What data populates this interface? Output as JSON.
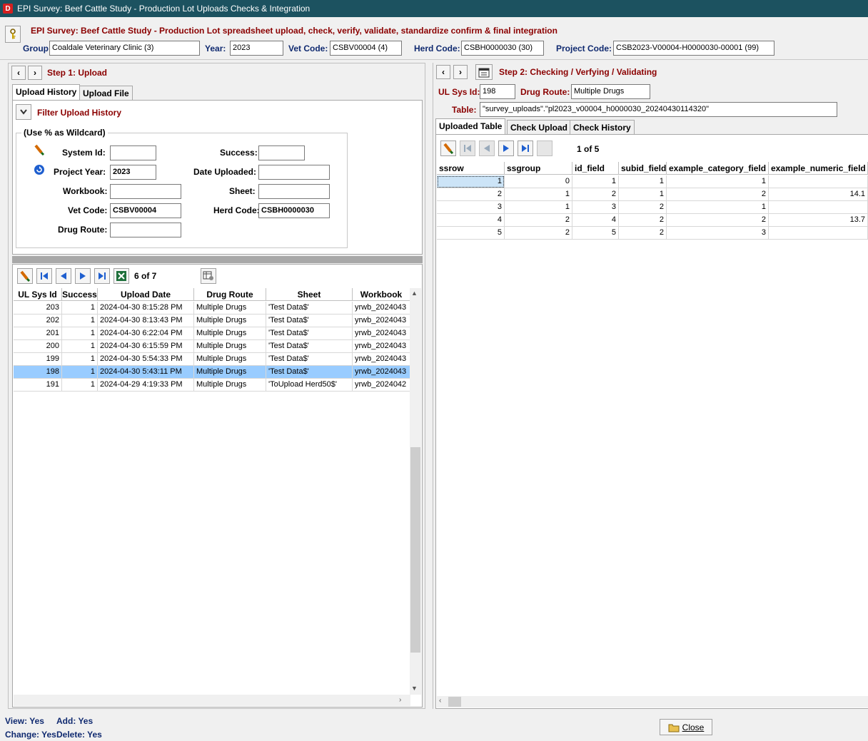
{
  "window": {
    "title": "EPI Survey: Beef Cattle Study - Production Lot Uploads Checks & Integration"
  },
  "header": {
    "title": "EPI Survey: Beef Cattle Study - Production Lot spreadsheet upload, check, verify, validate, standardize confirm & final integration",
    "group_label": "Group:",
    "group_value": "Coaldale Veterinary Clinic (3)",
    "year_label": "Year:",
    "year_value": "2023",
    "vet_label": "Vet Code:",
    "vet_value": "CSBV00004 (4)",
    "herd_label": "Herd Code:",
    "herd_value": "CSBH0000030 (30)",
    "project_label": "Project Code:",
    "project_value": "CSB2023-V00004-H0000030-00001 (99)"
  },
  "step1": {
    "title": "Step 1: Upload",
    "tabs": [
      "Upload History",
      "Upload File"
    ],
    "filter_title": "Filter Upload History",
    "wildcard_legend": "(Use % as Wildcard)",
    "filters": {
      "system_id_label": "System Id:",
      "system_id_value": "",
      "success_label": "Success:",
      "success_value": "",
      "project_year_label": "Project Year:",
      "project_year_value": "2023",
      "date_uploaded_label": "Date Uploaded:",
      "date_uploaded_value": "",
      "workbook_label": "Workbook:",
      "workbook_value": "",
      "sheet_label": "Sheet:",
      "sheet_value": "",
      "vet_code_label": "Vet Code:",
      "vet_code_value": "CSBV00004",
      "herd_code_label": "Herd Code:",
      "herd_code_value": "CSBH0000030",
      "drug_route_label": "Drug Route:",
      "drug_route_value": ""
    },
    "record_count": "6 of 7",
    "columns": [
      "UL Sys Id",
      "Success",
      "Upload Date",
      "Drug Route",
      "Sheet",
      "Workbook"
    ],
    "rows": [
      [
        "203",
        "1",
        "2024-04-30 8:15:28 PM",
        "Multiple Drugs",
        "'Test Data$'",
        "yrwb_2024043"
      ],
      [
        "202",
        "1",
        "2024-04-30 8:13:43 PM",
        "Multiple Drugs",
        "'Test Data$'",
        "yrwb_2024043"
      ],
      [
        "201",
        "1",
        "2024-04-30 6:22:04 PM",
        "Multiple Drugs",
        "'Test Data$'",
        "yrwb_2024043"
      ],
      [
        "200",
        "1",
        "2024-04-30 6:15:59 PM",
        "Multiple Drugs",
        "'Test Data$'",
        "yrwb_2024043"
      ],
      [
        "199",
        "1",
        "2024-04-30 5:54:33 PM",
        "Multiple Drugs",
        "'Test Data$'",
        "yrwb_2024043"
      ],
      [
        "198",
        "1",
        "2024-04-30 5:43:11 PM",
        "Multiple Drugs",
        "'Test Data$'",
        "yrwb_2024043"
      ],
      [
        "191",
        "1",
        "2024-04-29 4:19:33 PM",
        "Multiple Drugs",
        "'ToUpload Herd50$'",
        "yrwb_2024042"
      ]
    ],
    "selected_row": 5
  },
  "step2": {
    "title": "Step 2: Checking / Verfying / Validating",
    "ul_sys_id_label": "UL Sys Id:",
    "ul_sys_id_value": "198",
    "drug_route_label": "Drug Route:",
    "drug_route_value": "Multiple Drugs",
    "table_label": "Table:",
    "table_value": "\"survey_uploads\".\"pl2023_v00004_h0000030_20240430114320\"",
    "tabs": [
      "Uploaded Table",
      "Check Upload",
      "Check History"
    ],
    "record_count": "1 of 5",
    "columns": [
      "ssrow",
      "ssgroup",
      "id_field",
      "subid_field",
      "example_category_field",
      "example_numeric_field"
    ],
    "rows": [
      [
        "1",
        "0",
        "1",
        "1",
        "1",
        ""
      ],
      [
        "2",
        "1",
        "2",
        "1",
        "2",
        "14.1"
      ],
      [
        "3",
        "1",
        "3",
        "2",
        "1",
        ""
      ],
      [
        "4",
        "2",
        "4",
        "2",
        "2",
        "13.7"
      ],
      [
        "5",
        "2",
        "5",
        "2",
        "3",
        ""
      ]
    ]
  },
  "footer": {
    "view": "View: Yes",
    "add": "Add: Yes",
    "change": "Change: Yes",
    "delete": "Delete: Yes",
    "close_label": "Close"
  }
}
